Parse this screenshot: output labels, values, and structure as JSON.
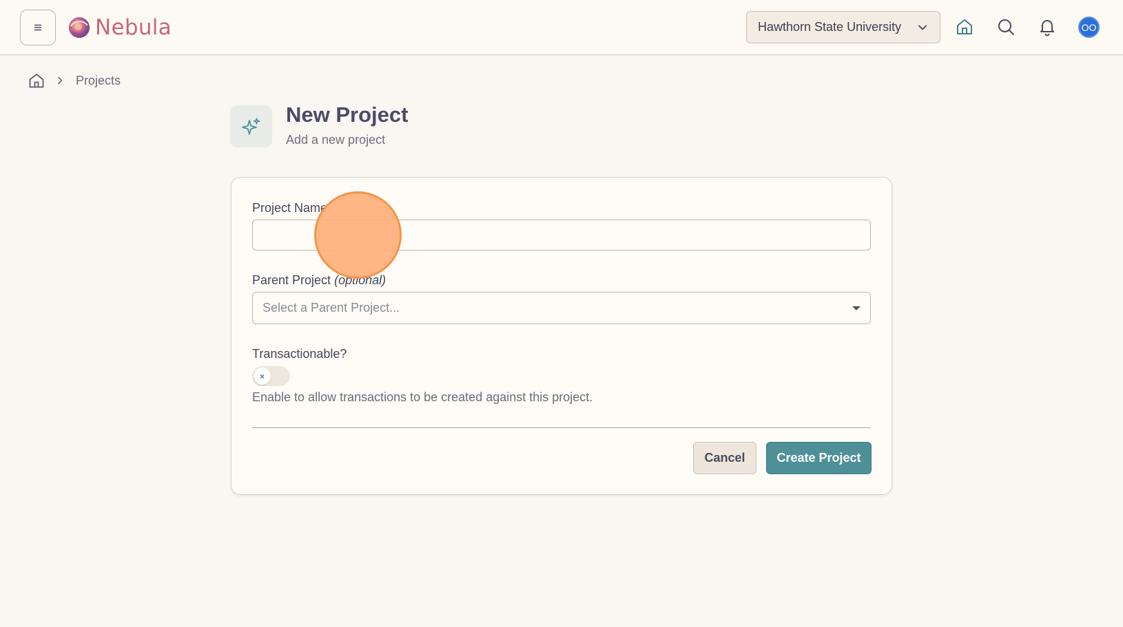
{
  "app": {
    "name": "Nebula",
    "colors": {
      "accent": "#4f8f98",
      "brand": "#c8677a",
      "avatar": "#2c6fd8",
      "background": "#faf6f1"
    }
  },
  "topbar": {
    "menu_icon": "hamburger-icon",
    "organization": "Hawthorn State University",
    "icons": [
      "home-icon",
      "search-icon",
      "bell-icon"
    ],
    "avatar_initials": "OO"
  },
  "breadcrumb": {
    "home_icon": "home-icon",
    "items": [
      "Projects"
    ]
  },
  "header": {
    "icon": "sparkles-icon",
    "title": "New Project",
    "subtitle": "Add a new project"
  },
  "form": {
    "project_name": {
      "label": "Project Name",
      "value": "",
      "placeholder": ""
    },
    "parent_project": {
      "label": "Parent Project",
      "label_suffix": "(optional)",
      "placeholder": "Select a Parent Project..."
    },
    "transactionable": {
      "label": "Transactionable?",
      "enabled": false,
      "knob_glyph": "×",
      "help": "Enable to allow transactions to be created against this project."
    },
    "actions": {
      "cancel": "Cancel",
      "create": "Create Project"
    }
  }
}
